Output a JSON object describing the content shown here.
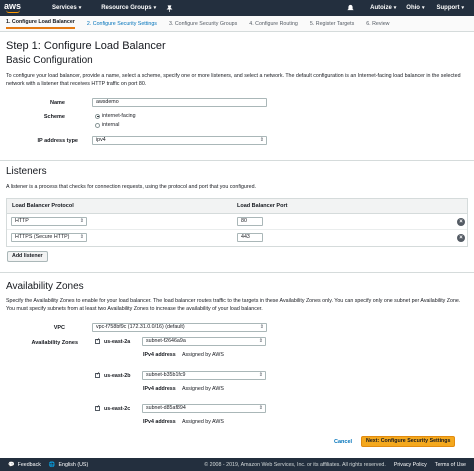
{
  "nav": {
    "logo": "aws",
    "services": "Services",
    "resource_groups": "Resource Groups",
    "account": "Autoize",
    "region": "Ohio",
    "support": "Support"
  },
  "steps": [
    "1. Configure Load Balancer",
    "2. Configure Security Settings",
    "3. Configure Security Groups",
    "4. Configure Routing",
    "5. Register Targets",
    "6. Review"
  ],
  "page_title": "Step 1: Configure Load Balancer",
  "basic": {
    "title": "Basic Configuration",
    "description": "To configure your load balancer, provide a name, select a scheme, specify one or more listeners, and select a network. The default configuration is an Internet-facing load balancer in the selected network with a listener that receives HTTP traffic on port 80.",
    "name_label": "Name",
    "name_value": "awsdemo",
    "scheme_label": "Scheme",
    "scheme_options": [
      "internet-facing",
      "internal"
    ],
    "ip_label": "IP address type",
    "ip_value": "ipv4"
  },
  "listeners": {
    "title": "Listeners",
    "description": "A listener is a process that checks for connection requests, using the protocol and port that you configured.",
    "col_protocol": "Load Balancer Protocol",
    "col_port": "Load Balancer Port",
    "rows": [
      {
        "protocol": "HTTP",
        "port": "80"
      },
      {
        "protocol": "HTTPS (Secure HTTP)",
        "port": "443"
      }
    ],
    "add_label": "Add listener"
  },
  "az": {
    "title": "Availability Zones",
    "description": "Specify the Availability Zones to enable for your load balancer. The load balancer routes traffic to the targets in these Availability Zones only. You can specify only one subnet per Availability Zone. You must specify subnets from at least two Availability Zones to increase the availability of your load balancer.",
    "vpc_label": "VPC",
    "vpc_value": "vpc-f758bf9c (172.31.0.0/16) (default)",
    "zones_label": "Availability Zones",
    "ipv4_label": "IPv4 address",
    "assigned": "Assigned by AWS",
    "zones": [
      {
        "name": "us-east-2a",
        "subnet": "subnet-f2646a9a"
      },
      {
        "name": "us-east-2b",
        "subnet": "subnet-b35b1fc9"
      },
      {
        "name": "us-east-2c",
        "subnet": "subnet-d85af894"
      }
    ]
  },
  "actions": {
    "cancel": "Cancel",
    "next": "Next: Configure Security Settings"
  },
  "footer": {
    "feedback": "Feedback",
    "language": "English (US)",
    "copyright": "© 2008 - 2019, Amazon Web Services, Inc. or its affiliates. All rights reserved.",
    "privacy": "Privacy Policy",
    "terms": "Terms of Use"
  }
}
